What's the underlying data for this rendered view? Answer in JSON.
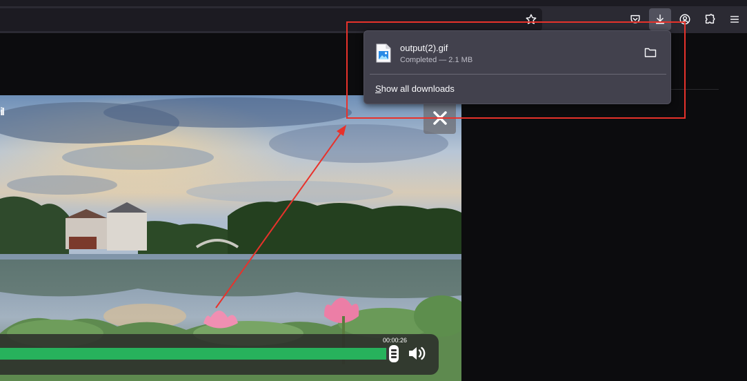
{
  "browser": {
    "toolbar_buttons": [
      {
        "name": "bookmark-star-icon"
      },
      {
        "name": "pocket-icon"
      },
      {
        "name": "downloads-icon",
        "active": true
      },
      {
        "name": "account-icon"
      },
      {
        "name": "extensions-icon"
      },
      {
        "name": "menu-icon"
      }
    ]
  },
  "video": {
    "watermark": "iI",
    "current_time": "00:00:26",
    "progress_fraction": 0.99,
    "close_icon": "close-icon",
    "volume_icon": "volume-icon"
  },
  "downloads_panel": {
    "items": [
      {
        "file_name": "output(2).gif",
        "status": "Completed — 2.1 MB",
        "icon": "image-file-icon",
        "action_icon": "folder-icon"
      }
    ],
    "show_all_prefix": "S",
    "show_all_rest": "how all downloads"
  },
  "colors": {
    "annotation": "#e8322b",
    "progress": "#27b25c",
    "panel_bg": "#42414d",
    "toolbar_bg": "#2b2a33"
  }
}
